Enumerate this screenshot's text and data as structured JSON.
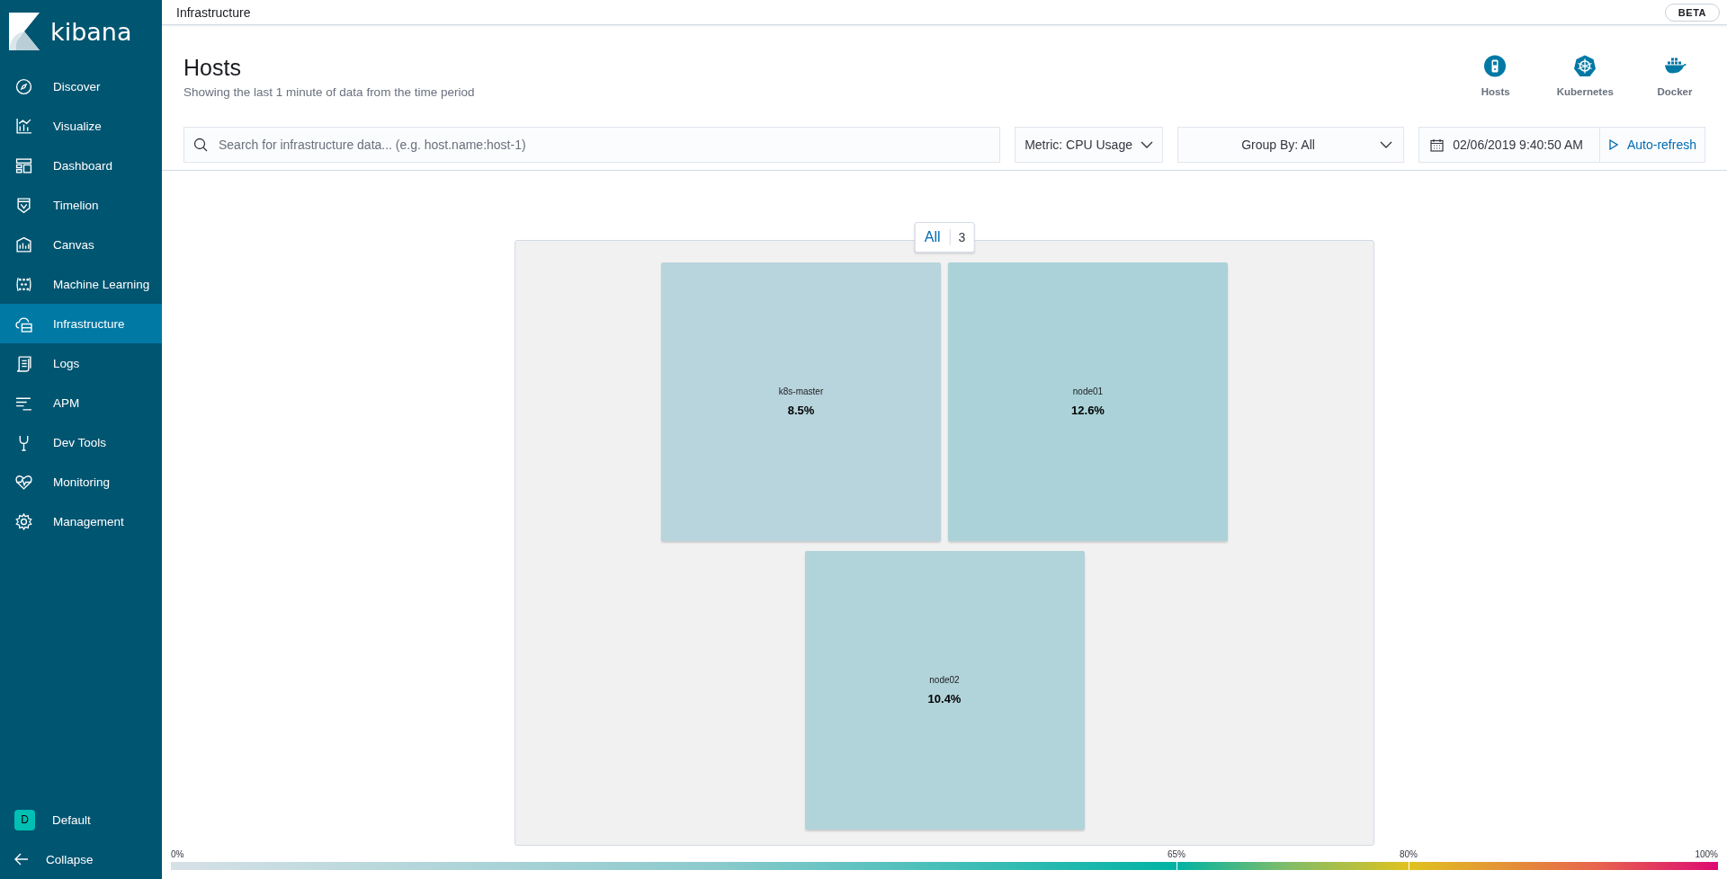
{
  "sidebar": {
    "brand": "kibana",
    "items": [
      {
        "label": "Discover",
        "selected": false
      },
      {
        "label": "Visualize",
        "selected": false
      },
      {
        "label": "Dashboard",
        "selected": false
      },
      {
        "label": "Timelion",
        "selected": false
      },
      {
        "label": "Canvas",
        "selected": false
      },
      {
        "label": "Machine Learning",
        "selected": false
      },
      {
        "label": "Infrastructure",
        "selected": true
      },
      {
        "label": "Logs",
        "selected": false
      },
      {
        "label": "APM",
        "selected": false
      },
      {
        "label": "Dev Tools",
        "selected": false
      },
      {
        "label": "Monitoring",
        "selected": false
      },
      {
        "label": "Management",
        "selected": false
      }
    ],
    "space": {
      "initial": "D",
      "label": "Default"
    },
    "collapse": "Collapse"
  },
  "top_bar": {
    "breadcrumb": "Infrastructure",
    "badge": "BETA"
  },
  "header": {
    "title": "Hosts",
    "subtitle": "Showing the last 1 minute of data from the time period",
    "views": [
      {
        "label": "Hosts"
      },
      {
        "label": "Kubernetes"
      },
      {
        "label": "Docker"
      }
    ]
  },
  "toolbar": {
    "search": {
      "placeholder": "Search for infrastructure data... (e.g. host.name:host-1)"
    },
    "metric": "Metric: CPU Usage",
    "group_by": "Group By: All",
    "date": "02/06/2019 9:40:50 AM",
    "auto_refresh": "Auto-refresh"
  },
  "map": {
    "group_label": "All",
    "group_count": "3",
    "nodes": [
      {
        "name": "k8s-master",
        "value": "8.5%",
        "color": "#b8d4dc"
      },
      {
        "name": "node01",
        "value": "12.6%",
        "color": "#aad2d8"
      },
      {
        "name": "node02",
        "value": "10.4%",
        "color": "#b1d4da"
      }
    ]
  },
  "legend": {
    "stops": [
      {
        "label": "0%",
        "level": 0
      },
      {
        "label": "65%",
        "level": 0.65
      },
      {
        "label": "80%",
        "level": 0.8
      },
      {
        "label": "100%",
        "level": 1
      }
    ]
  }
}
